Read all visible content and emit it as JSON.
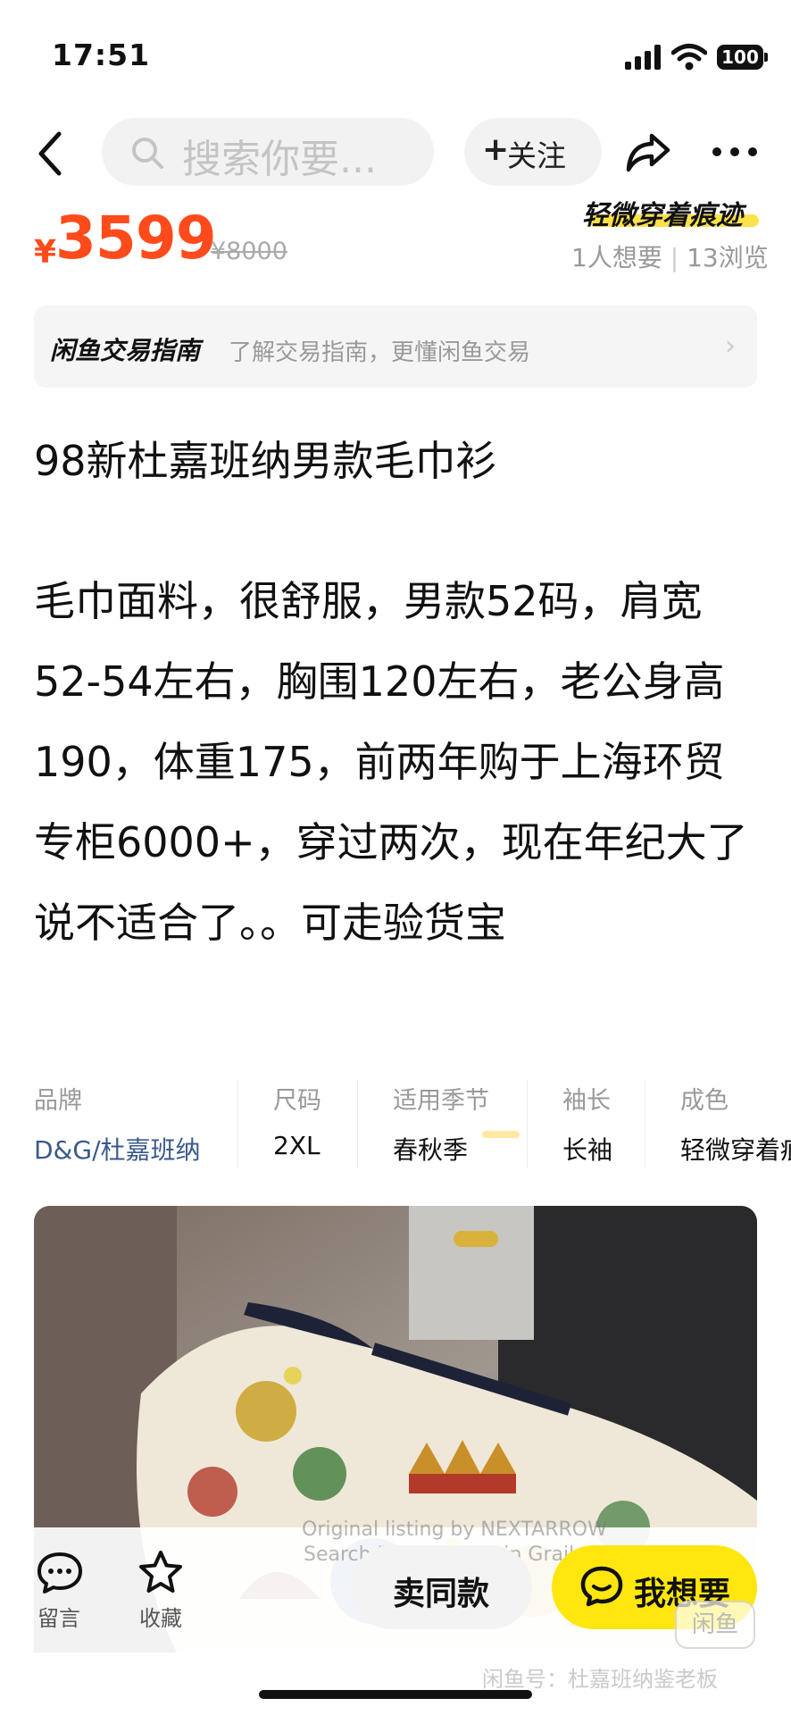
{
  "status_bar": {
    "time": "17:51",
    "battery": "100"
  },
  "nav": {
    "search_placeholder": "搜索你要...",
    "follow_label": "关注"
  },
  "price": {
    "currency": "¥",
    "current": "3599",
    "original": "¥8000"
  },
  "condition_tag": "轻微穿着痕迹",
  "stats": {
    "wants": "1人想要",
    "views": "13浏览"
  },
  "guide": {
    "title": "闲鱼交易指南",
    "subtitle": "了解交易指南，更懂闲鱼交易"
  },
  "item": {
    "title": "98新杜嘉班纳男款毛巾衫",
    "description": "毛巾面料，很舒服，男款52码，肩宽52-54左右，胸围120左右，老公身高190，体重175，前两年购于上海环贸专柜6000+，穿过两次，现在年纪大了说不适合了。。可走验货宝"
  },
  "attributes": [
    {
      "label": "品牌",
      "value": "D&G/杜嘉班纳"
    },
    {
      "label": "尺码",
      "value": "2XL"
    },
    {
      "label": "适用季节",
      "value": "春秋季"
    },
    {
      "label": "袖长",
      "value": "长袖"
    },
    {
      "label": "成色",
      "value": "轻微穿着痕"
    }
  ],
  "overlay": {
    "watermark_line1": "Original listing by NEXTARROW",
    "watermark_line2": "Search \"NexTarrow\" in Grailed app.",
    "seller_watermark": "闲鱼号：杜嘉班纳鉴老板",
    "badge": "闲鱼"
  },
  "bottom_bar": {
    "comment_label": "留言",
    "favorite_label": "收藏",
    "same_item_label": "卖同款",
    "want_label": "我想要"
  },
  "colors": {
    "price": "#ff4a1c",
    "accent_yellow": "#ffe60f",
    "brand_link": "#3a5a8c"
  }
}
